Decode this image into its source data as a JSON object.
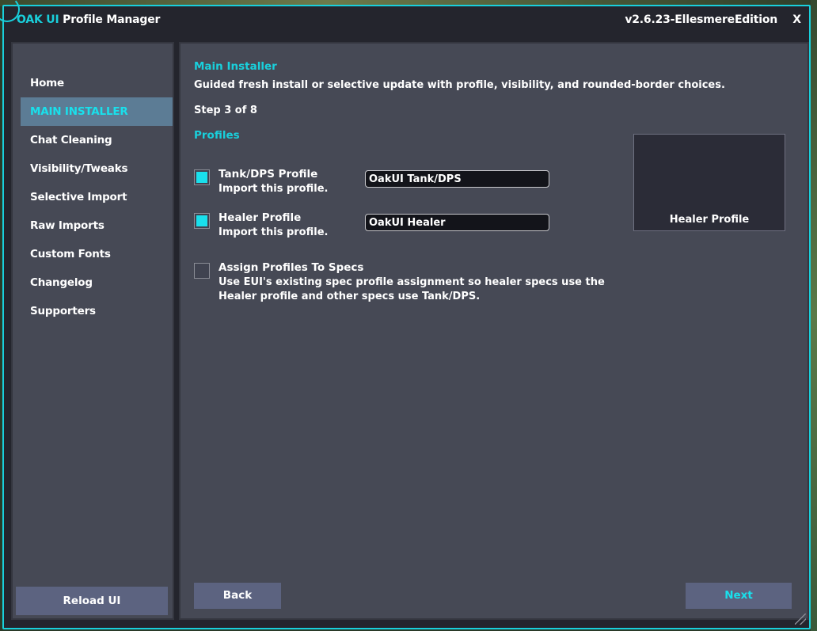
{
  "window": {
    "title_accent": "OAK UI",
    "title_rest": " Profile Manager",
    "version": "v2.6.23-EllesmereEdition",
    "close_label": "X"
  },
  "sidebar": {
    "items": [
      {
        "label": "Home",
        "active": false
      },
      {
        "label": "MAIN INSTALLER",
        "active": true
      },
      {
        "label": "Chat Cleaning",
        "active": false
      },
      {
        "label": "Visibility/Tweaks",
        "active": false
      },
      {
        "label": "Selective Import",
        "active": false
      },
      {
        "label": "Raw Imports",
        "active": false
      },
      {
        "label": "Custom Fonts",
        "active": false
      },
      {
        "label": "Changelog",
        "active": false
      },
      {
        "label": "Supporters",
        "active": false
      }
    ],
    "reload_label": "Reload UI"
  },
  "main": {
    "heading": "Main Installer",
    "description": "Guided fresh install or selective update with profile, visibility, and rounded-border choices.",
    "step": "Step 3 of 8",
    "section": "Profiles",
    "options": [
      {
        "label": "Tank/DPS Profile",
        "desc": "Import this profile.",
        "checked": true,
        "value": "OakUI Tank/DPS"
      },
      {
        "label": "Healer Profile",
        "desc": "Import this profile.",
        "checked": true,
        "value": "OakUI Healer"
      }
    ],
    "assign": {
      "label": "Assign Profiles To Specs",
      "desc": "Use EUI's existing spec profile assignment so healer specs use the Healer profile and other specs use Tank/DPS.",
      "checked": false
    },
    "preview_label": "Healer Profile",
    "back_label": "Back",
    "next_label": "Next"
  },
  "colors": {
    "accent": "#19d0dc",
    "panel": "#464955",
    "button": "#5c6380",
    "active_nav": "#5c7c95"
  }
}
